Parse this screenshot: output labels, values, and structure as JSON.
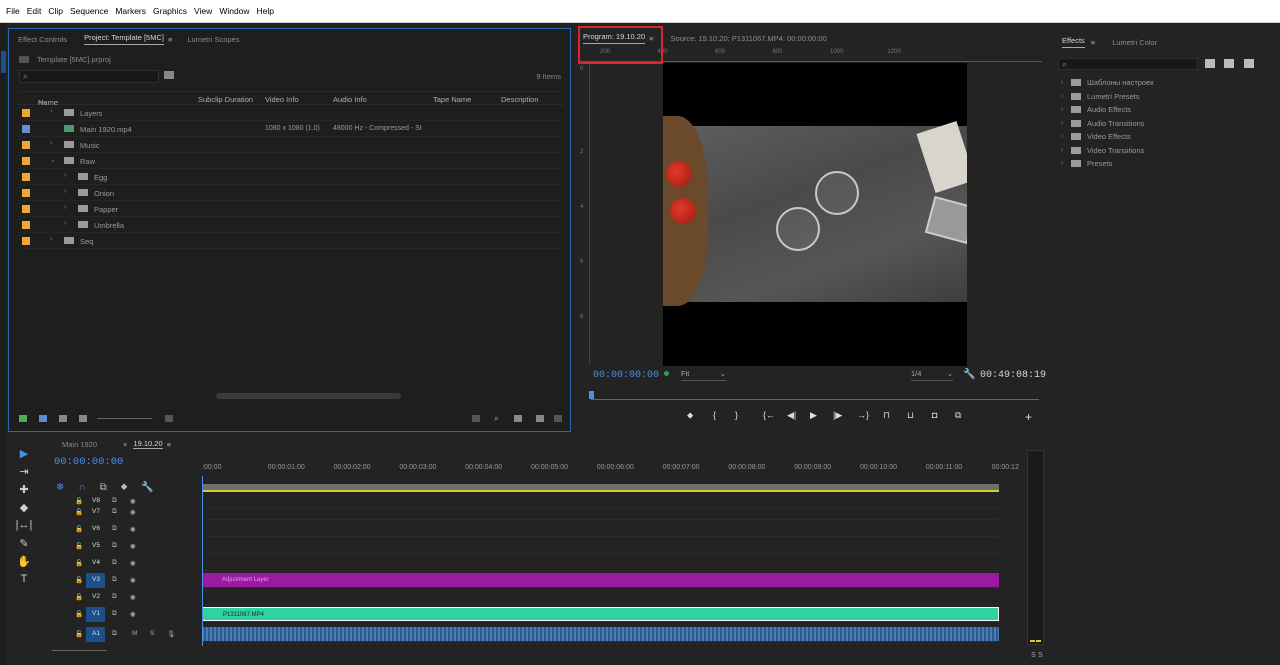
{
  "menu": [
    "File",
    "Edit",
    "Clip",
    "Sequence",
    "Markers",
    "Graphics",
    "View",
    "Window",
    "Help"
  ],
  "project_panel": {
    "tabs": [
      "Effect Controls",
      "Project: Template [5MC]",
      "Lumetri Scopes"
    ],
    "project_file": "Template [5MC].prproj",
    "item_count": "9 Items",
    "columns": [
      "Name",
      "Subclip Duration",
      "Video Info",
      "Audio Info",
      "Tape Name",
      "Description"
    ],
    "rows": [
      {
        "name": "Layers",
        "color": "#f0a830",
        "level": 0,
        "expanded": false
      },
      {
        "name": "Main 1920.mp4",
        "color": "#6a8fd0",
        "level": 0,
        "video": "1080 x 1080 (1.0)",
        "audio": "48000 Hz - Compressed - St"
      },
      {
        "name": "Music",
        "color": "#f0a830",
        "level": 0,
        "expanded": false
      },
      {
        "name": "Raw",
        "color": "#f0a830",
        "level": 0,
        "expanded": true
      },
      {
        "name": "Egg",
        "color": "#f0a830",
        "level": 1,
        "expanded": false
      },
      {
        "name": "Onion",
        "color": "#f0a830",
        "level": 1,
        "expanded": false
      },
      {
        "name": "Papper",
        "color": "#f0a830",
        "level": 1,
        "expanded": false
      },
      {
        "name": "Umbrella",
        "color": "#f0a830",
        "level": 1,
        "expanded": false
      },
      {
        "name": "Seq",
        "color": "#f0a830",
        "level": 0,
        "expanded": false
      }
    ]
  },
  "program_monitor": {
    "tab_label": "Program: 19.10.20",
    "source_label": "Source: 19.10.20: P1311067.MP4: 00:00:00:00",
    "ruler_marks": [
      "200",
      "400",
      "600",
      "800",
      "1000",
      "1200"
    ],
    "timecode": "00:00:00:00",
    "zoom": "Fit",
    "resolution": "1/4",
    "duration": "00:49:08:19"
  },
  "effects_panel": {
    "tabs": [
      "Effects",
      "Lumetri Color"
    ],
    "items": [
      "Шаблоны настроек",
      "Lumetri Presets",
      "Audio Effects",
      "Audio Transitions",
      "Video Effects",
      "Video Transitions",
      "Presets"
    ]
  },
  "timeline": {
    "tabs": [
      "Main 1920",
      "19.10.20"
    ],
    "timecode": "00:00:00:00",
    "ruler": [
      ":00:00",
      "00:00:01:00",
      "00:00:02:00",
      "00:00:03:00",
      "00:00:04:00",
      "00:00:05:00",
      "00:00:06:00",
      "00:00:07:00",
      "00:00:08:00",
      "00:00:09:00",
      "00:00:10:00",
      "00:00:11:00",
      "00:00:12"
    ],
    "tracks": [
      "V8",
      "V7",
      "V6",
      "V5",
      "V4",
      "V3",
      "V2",
      "V1",
      "A1"
    ],
    "clips": {
      "adjustment": "Adjustment Layer",
      "video": "P1311067.MP4"
    },
    "track_buttons": {
      "mute": "M",
      "solo": "S"
    },
    "meter_labels": [
      "S",
      "S"
    ]
  }
}
